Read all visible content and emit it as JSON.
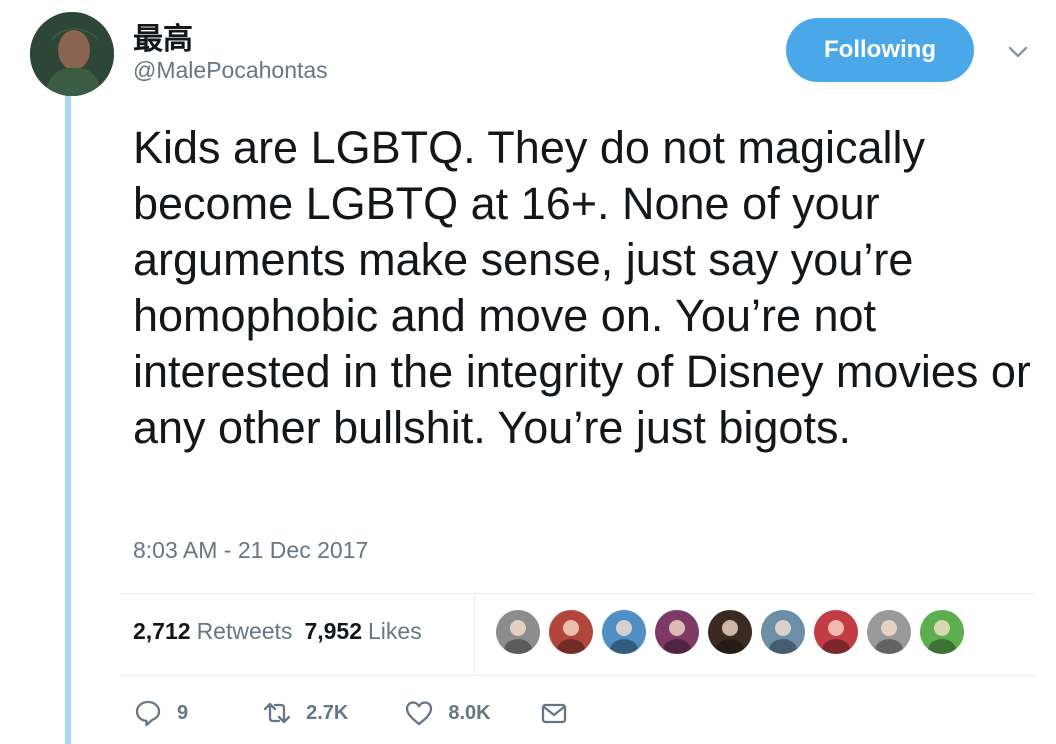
{
  "author": {
    "display_name": "最高",
    "handle": "@MalePocahontas",
    "avatar_icon": "user-avatar"
  },
  "follow_button_label": "Following",
  "tweet_text": "Kids are LGBTQ. They do not magically become LGBTQ at 16+. None of your arguments make sense, just say you’re homophobic and move on. You’re not interested in the integrity of Disney movies or any other bullshit. You’re just bigots.",
  "timestamp": "8:03 AM - 21 Dec 2017",
  "stats": {
    "retweets_count": "2,712",
    "retweets_label": "Retweets",
    "likes_count": "7,952",
    "likes_label": "Likes"
  },
  "liker_avatars": [
    "#8c8c8c",
    "#b1463d",
    "#4f8fc4",
    "#7d3a66",
    "#3b2a22",
    "#6b8fa6",
    "#c23b45",
    "#999999",
    "#5cae4f"
  ],
  "actions": {
    "reply_count": "9",
    "retweet_count": "2.7K",
    "like_count": "8.0K"
  },
  "colors": {
    "accent": "#4aa8e8",
    "thread_line": "#a8d8f2",
    "secondary_text": "#657786"
  }
}
